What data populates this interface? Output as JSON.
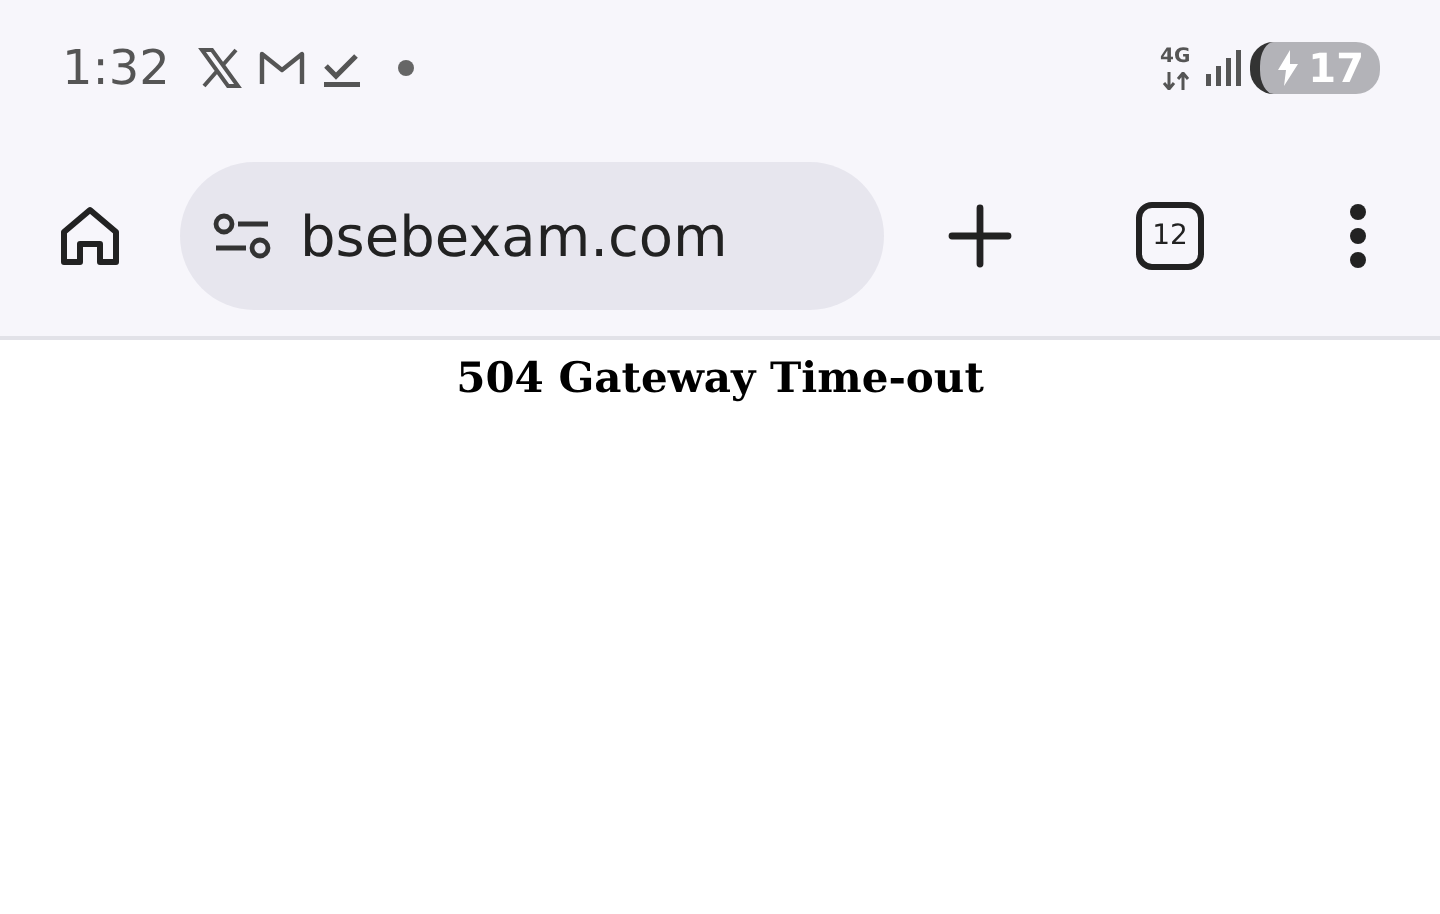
{
  "status_bar": {
    "time": "1:32",
    "network": "4G",
    "battery": "17"
  },
  "toolbar": {
    "url": "bsebexam.com",
    "tab_count": "12"
  },
  "page": {
    "heading": "504 Gateway Time-out"
  }
}
